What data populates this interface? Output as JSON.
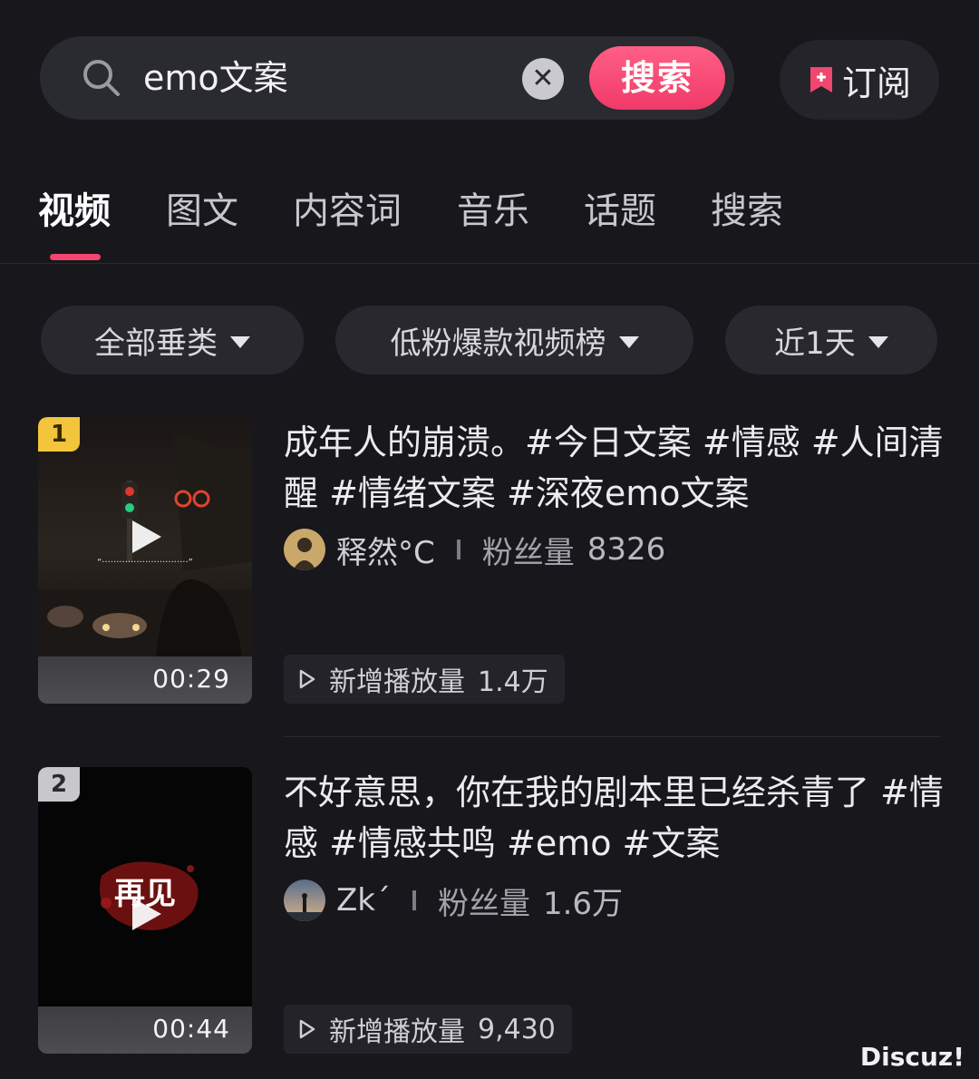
{
  "search": {
    "query": "emo文案",
    "button_label": "搜索"
  },
  "subscribe": {
    "label": "订阅"
  },
  "tabs": [
    {
      "label": "视频",
      "active": true
    },
    {
      "label": "图文"
    },
    {
      "label": "内容词"
    },
    {
      "label": "音乐"
    },
    {
      "label": "话题"
    },
    {
      "label": "搜索"
    }
  ],
  "filters": [
    {
      "label": "全部垂类"
    },
    {
      "label": "低粉爆款视频榜"
    },
    {
      "label": "近1天"
    }
  ],
  "results": [
    {
      "rank": "1",
      "duration": "00:29",
      "title": "成年人的崩溃。#今日文案 #情感 #人间清醒 #情绪文案 #深夜emo文案",
      "author": "释然°C",
      "fans_label": "粉丝量",
      "fans_value": "8326",
      "stat_label": "新增播放量",
      "stat_value": "1.4万"
    },
    {
      "rank": "2",
      "duration": "00:44",
      "thumb_text": "再见",
      "title": "不好意思，你在我的剧本里已经杀青了 #情感 #情感共鸣 #emo #文案",
      "author": "Zk´",
      "fans_label": "粉丝量",
      "fans_value": "1.6万",
      "stat_label": "新增播放量",
      "stat_value": "9,430"
    }
  ],
  "watermark": "Discuz!",
  "colors": {
    "accent": "#f0466f",
    "background": "#17171c",
    "rank1": "#f2c53d",
    "rank2": "#c8c8cc"
  }
}
